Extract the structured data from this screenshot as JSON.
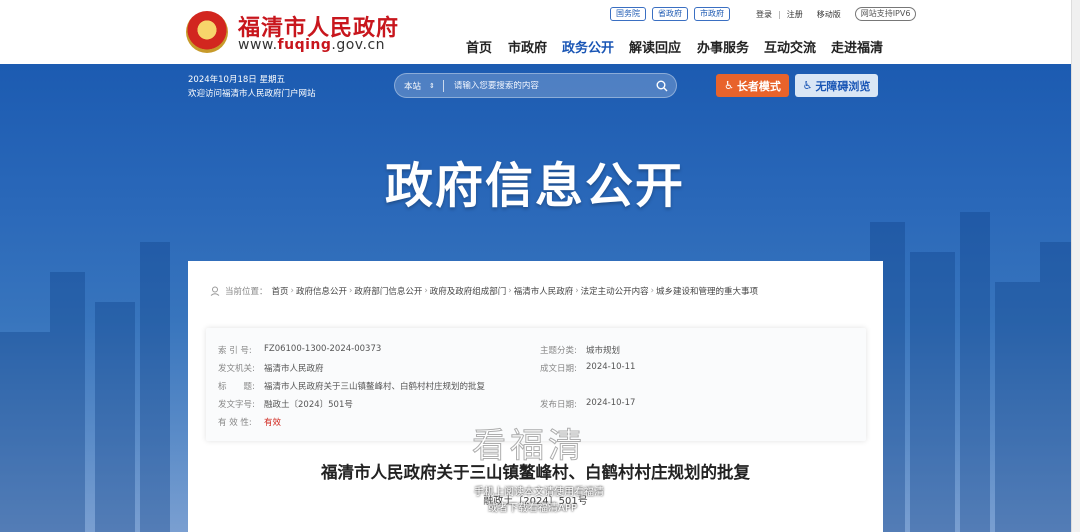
{
  "header": {
    "site_name": "福清市人民政府",
    "site_url_prefix": "www.",
    "site_url_brand": "fuqing",
    "site_url_suffix": ".gov.cn",
    "pills": [
      "国务院",
      "省政府",
      "市政府"
    ],
    "links": [
      "登录",
      "注册",
      "移动版"
    ],
    "ipv6": "网站支持IPV6",
    "nav": [
      "首页",
      "市政府",
      "政务公开",
      "解读回应",
      "办事服务",
      "互动交流",
      "走进福清"
    ],
    "active_nav": "政务公开"
  },
  "banner": {
    "date": "2024年10月18日 星期五",
    "welcome": "欢迎访问福清市人民政府门户网站",
    "search_scope": "本站",
    "search_placeholder": "请输入您要搜索的内容",
    "elder_mode": "长者模式",
    "accessible": "无障碍浏览",
    "title": "政府信息公开"
  },
  "breadcrumb": {
    "label": "当前位置：",
    "items": [
      "首页",
      "政府信息公开",
      "政府部门信息公开",
      "政府及政府组成部门",
      "福清市人民政府",
      "法定主动公开内容",
      "城乡建设和管理的重大事项"
    ]
  },
  "meta": {
    "index_no_label": "索 引 号:",
    "index_no": "FZ06100-1300-2024-00373",
    "category_label": "主题分类:",
    "category": "城市规划",
    "issuer_label": "发文机关:",
    "issuer": "福清市人民政府",
    "date_made_label": "成文日期:",
    "date_made": "2024-10-11",
    "subject_label": "标　　题:",
    "subject": "福清市人民政府关于三山镇鳌峰村、白鹤村村庄规划的批复",
    "doc_no_label": "发文字号:",
    "doc_no": "融政土〔2024〕501号",
    "pub_date_label": "发布日期:",
    "pub_date": "2024-10-17",
    "validity_label": "有 效 性:",
    "validity": "有效"
  },
  "doc": {
    "title": "福清市人民政府关于三山镇鳌峰村、白鹤村村庄规划的批复",
    "number": "融政土〔2024〕501号"
  },
  "watermark": {
    "big": "看福清",
    "line1": "手机上阅读本文请使用看福清",
    "line2": "或者下载看福清APP"
  }
}
